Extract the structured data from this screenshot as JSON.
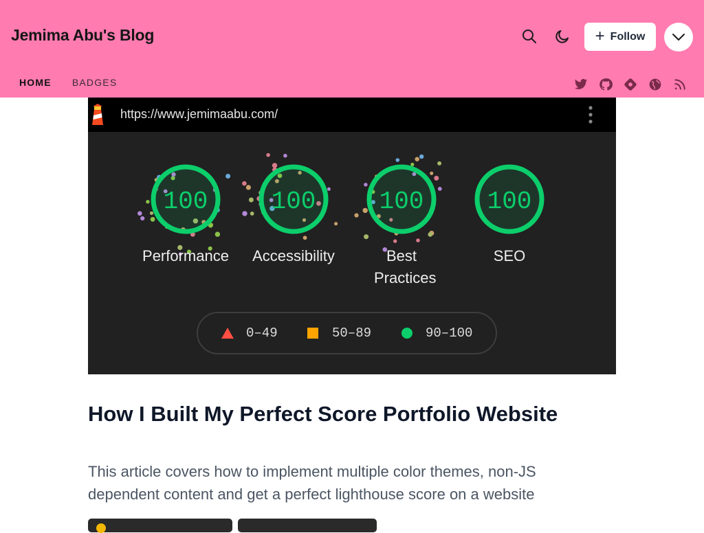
{
  "header": {
    "blog_title": "Jemima Abu's Blog",
    "follow_label": "Follow",
    "background": "#ff7bb0"
  },
  "nav": {
    "items": [
      {
        "label": "HOME",
        "active": true
      },
      {
        "label": "BADGES",
        "active": false
      }
    ]
  },
  "socials": [
    "twitter-icon",
    "github-icon",
    "hashnode-icon",
    "globe-icon",
    "rss-icon"
  ],
  "cover": {
    "url": "https://www.jemimaabu.com/",
    "gauges": [
      {
        "score": "100",
        "label": "Performance"
      },
      {
        "score": "100",
        "label": "Accessibility"
      },
      {
        "score": "100",
        "label": "Best Practices"
      },
      {
        "score": "100",
        "label": "SEO"
      }
    ],
    "legend": [
      {
        "range": "0–49",
        "shape": "triangle",
        "color": "#ff4e42"
      },
      {
        "range": "50–89",
        "shape": "square",
        "color": "#ffa400"
      },
      {
        "range": "90–100",
        "shape": "circle",
        "color": "#0cce6b"
      }
    ]
  },
  "article": {
    "title": "How I Built My Perfect Score Portfolio Website",
    "subtitle": "This article covers how to implement multiple color themes, non-JS dependent content and get a perfect lighthouse score on a website"
  }
}
